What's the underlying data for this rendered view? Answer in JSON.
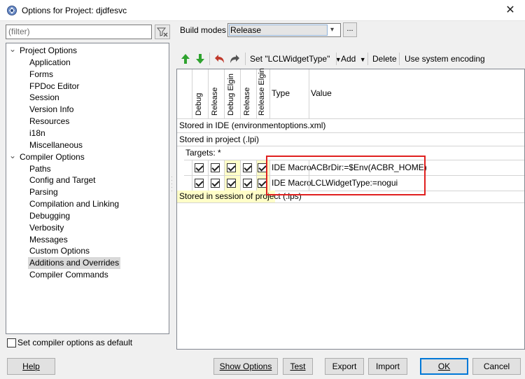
{
  "window": {
    "title": "Options for Project: djdfesvc",
    "close_glyph": "✕"
  },
  "filter": {
    "placeholder": "(filter)"
  },
  "tree": {
    "items": [
      {
        "label": "Project Options",
        "level": 0,
        "expanded": true
      },
      {
        "label": "Application",
        "level": 1
      },
      {
        "label": "Forms",
        "level": 1
      },
      {
        "label": "FPDoc Editor",
        "level": 1
      },
      {
        "label": "Session",
        "level": 1
      },
      {
        "label": "Version Info",
        "level": 1
      },
      {
        "label": "Resources",
        "level": 1
      },
      {
        "label": "i18n",
        "level": 1
      },
      {
        "label": "Miscellaneous",
        "level": 1
      },
      {
        "label": "Compiler Options",
        "level": 0,
        "expanded": true
      },
      {
        "label": "Paths",
        "level": 1
      },
      {
        "label": "Config and Target",
        "level": 1
      },
      {
        "label": "Parsing",
        "level": 1
      },
      {
        "label": "Compilation and Linking",
        "level": 1
      },
      {
        "label": "Debugging",
        "level": 1
      },
      {
        "label": "Verbosity",
        "level": 1
      },
      {
        "label": "Messages",
        "level": 1
      },
      {
        "label": "Custom Options",
        "level": 1
      },
      {
        "label": "Additions and Overrides",
        "level": 1,
        "selected": true
      },
      {
        "label": "Compiler Commands",
        "level": 1
      }
    ]
  },
  "default_checkbox": {
    "label": "Set compiler options as default",
    "checked": false
  },
  "build_modes": {
    "label": "Build modes",
    "value": "Release",
    "more": "..."
  },
  "toolbar": {
    "up_icon": "green-up-arrow-icon",
    "down_icon": "green-down-arrow-icon",
    "undo_icon": "undo-arrow-icon",
    "redo_icon": "redo-arrow-icon",
    "set_label": "Set \"LCLWidgetType\"",
    "add_label": "Add",
    "delete_label": "Delete",
    "encoding_label": "Use system encoding"
  },
  "grid": {
    "mode_headers": [
      "Debug",
      "Release",
      "Debug Elgin",
      "Release",
      "Release Elgin"
    ],
    "type_header": "Type",
    "value_header": "Value",
    "sections": {
      "ide": "Stored in IDE (environmentoptions.xml)",
      "project": "Stored in project (.lpi)",
      "targets": "Targets: *",
      "session": "Stored in session of project (.lps)"
    },
    "rows": [
      {
        "checks": [
          true,
          true,
          true,
          true,
          true
        ],
        "type": "IDE Macro",
        "value": "ACBrDir:=$Env(ACBR_HOME)"
      },
      {
        "checks": [
          true,
          true,
          true,
          true,
          true
        ],
        "type": "IDE Macro",
        "value": "LCLWidgetType:=nogui"
      }
    ],
    "highlight_color": "#e0201f"
  },
  "buttons": {
    "help": "Help",
    "show_options": "Show Options",
    "test": "Test",
    "export": "Export",
    "import": "Import",
    "ok": "OK",
    "cancel": "Cancel"
  },
  "colors": {
    "accent": "#0078d7",
    "green_arrow": "#2fa32f",
    "undo_red": "#c0392b",
    "tree_selected": "#d9d9d9"
  }
}
